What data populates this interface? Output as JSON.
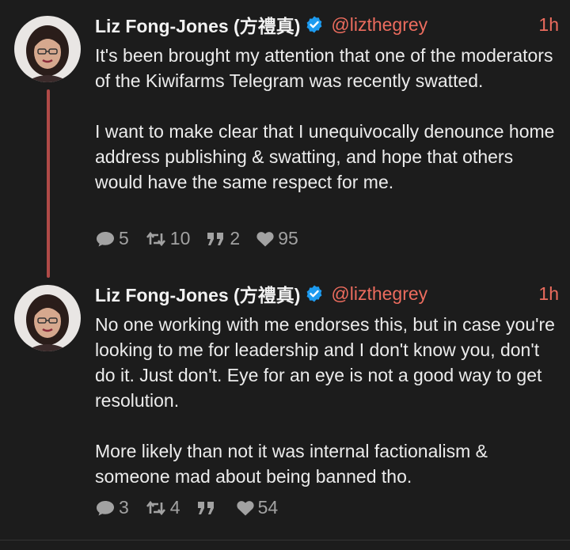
{
  "colors": {
    "background": "#1c1c1c",
    "accent": "#ec6c5e",
    "thread_line": "#b04a47",
    "verified": "#1d9bf0"
  },
  "posts": [
    {
      "author": "Liz Fong-Jones (方禮真)",
      "handle": "@lizthegrey",
      "time": "1h",
      "verified_icon": "verified-badge",
      "paragraphs": [
        "It's been brought my attention that one of the moderators of the Kiwifarms Telegram was recently swatted.",
        "I want to make clear that I unequivocally denounce home address publishing & swatting, and hope that others would have the same respect for me."
      ],
      "replies": "5",
      "reposts": "10",
      "quotes": "2",
      "likes": "95"
    },
    {
      "author": "Liz Fong-Jones (方禮真)",
      "handle": "@lizthegrey",
      "time": "1h",
      "verified_icon": "verified-badge",
      "paragraphs": [
        "No one working with me endorses this, but in case you're looking to me for leadership and I don't know you, don't do it. Just don't. Eye for an eye is not a good way to get resolution.",
        "More likely than not it was internal factionalism & someone mad about being banned tho."
      ],
      "replies": "3",
      "reposts": "4",
      "quotes": "",
      "likes": "54"
    }
  ]
}
